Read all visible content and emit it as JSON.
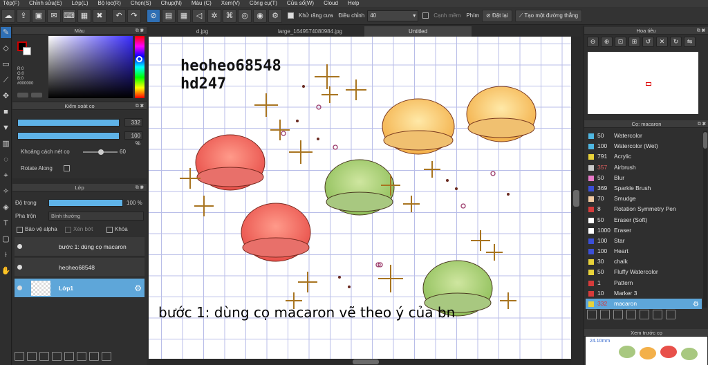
{
  "menu": [
    "Tệp(F)",
    "Chỉnh sửa(E)",
    "Lớp(L)",
    "Bộ lọc(R)",
    "Chọn(S)",
    "Chụp(N)",
    "Màu (C)",
    "Xem(V)",
    "Công cụ(T)",
    "Cửa sổ(W)",
    "Cloud",
    "Help"
  ],
  "toolbar": {
    "antialias_label": "Khử răng cưa",
    "adjust_label": "Điều chỉnh",
    "adjust_value": "40",
    "sharpen_label": "Cạnh mềm",
    "key_label": "Phím",
    "reset_label": "Đặt lại",
    "straight_line_label": "Tạo một đường thẳng"
  },
  "color_panel": {
    "title": "Màu",
    "rgb": [
      "R:0",
      "G:0",
      "B:0",
      "#000000"
    ]
  },
  "brush_control": {
    "title": "Kiểm soát cọ",
    "size_value": "332",
    "opacity_value": "100 %",
    "spacing_label": "Khoảng cách nét cọ",
    "spacing_value": "60",
    "rotate_label": "Rotate Along"
  },
  "layer_panel": {
    "title": "Lớp",
    "opacity_label": "Độ trong",
    "opacity_value": "100 %",
    "blend_label": "Pha trộn",
    "blend_value": "Bình thường",
    "protect_alpha": "Bảo vệ alpha",
    "clip": "Xén bớt",
    "lock": "Khóa",
    "layers": [
      {
        "name": "bước 1: dùng cọ macaron"
      },
      {
        "name": "heoheo68548"
      },
      {
        "name": "Lớp1"
      }
    ]
  },
  "tabs": [
    "d.jpg",
    "large_1649574080984.jpg",
    "Untitled"
  ],
  "canvas": {
    "signature_line1": "heoheo68548",
    "signature_line2": "hd247",
    "instruction": "bước 1: dùng cọ macaron vẽ theo ý của bn"
  },
  "navigator": {
    "title": "Hoa tiêu"
  },
  "brush_list": {
    "title": "Cọ: macaron",
    "items": [
      {
        "size": "50",
        "name": "Watercolor",
        "color": "#4fb6e0"
      },
      {
        "size": "100",
        "name": "Watercolor (Wet)",
        "color": "#4fb6e0"
      },
      {
        "size": "791",
        "name": "Acrylic",
        "color": "#e8d23a"
      },
      {
        "size": "357",
        "name": "Airbrush",
        "color": "#c9c9c9"
      },
      {
        "size": "50",
        "name": "Blur",
        "color": "#e879c9"
      },
      {
        "size": "369",
        "name": "Sparkle Brush",
        "color": "#3b4fd6"
      },
      {
        "size": "70",
        "name": "Smudge",
        "color": "#f0c9a0"
      },
      {
        "size": "8",
        "name": "Rotation Symmetry Pen",
        "color": "#d63b3b"
      },
      {
        "size": "50",
        "name": "Eraser (Soft)",
        "color": "#ffffff"
      },
      {
        "size": "1000",
        "name": "Eraser",
        "color": "#ffffff"
      },
      {
        "size": "100",
        "name": "Star",
        "color": "#3b4fd6"
      },
      {
        "size": "100",
        "name": "Heart",
        "color": "#3b4fd6"
      },
      {
        "size": "30",
        "name": "chalk",
        "color": "#e8d23a"
      },
      {
        "size": "50",
        "name": "Fluffy Watercolor",
        "color": "#e8d23a"
      },
      {
        "size": "1",
        "name": "Pattern",
        "color": "#d63b3b"
      },
      {
        "size": "10",
        "name": "Marker 3",
        "color": "#d63b3b"
      },
      {
        "size": "332",
        "name": "macaron",
        "color": "#e8d23a"
      }
    ]
  },
  "brush_preview": {
    "title": "Xem trước cọ",
    "size_text": "24.10mm"
  }
}
